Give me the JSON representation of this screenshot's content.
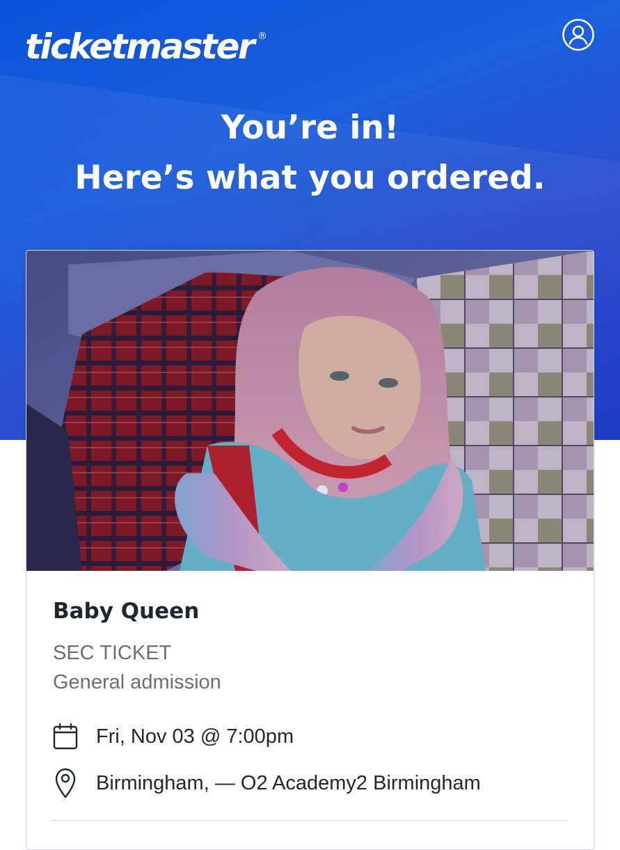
{
  "header": {
    "logo_text": "ticketmaster",
    "logo_mark": "®",
    "account_icon": "account-circle-icon"
  },
  "hero": {
    "line1": "You’re in!",
    "line2": "Here’s what you ordered."
  },
  "event": {
    "image_description_icon": "event-photo",
    "name": "Baby Queen",
    "ticket_type": "SEC TICKET",
    "admission": "General admission",
    "date_icon": "calendar-icon",
    "date_time": "Fri, Nov 03 @ 7:00pm",
    "venue_icon": "location-pin-icon",
    "venue": "Birmingham, — O2 Academy2 Birmingham"
  },
  "colors": {
    "brand_blue": "#1a5fdc",
    "deep_blue": "#1d3bc6",
    "text_primary": "#1f262d",
    "text_secondary": "#6b6e73"
  }
}
